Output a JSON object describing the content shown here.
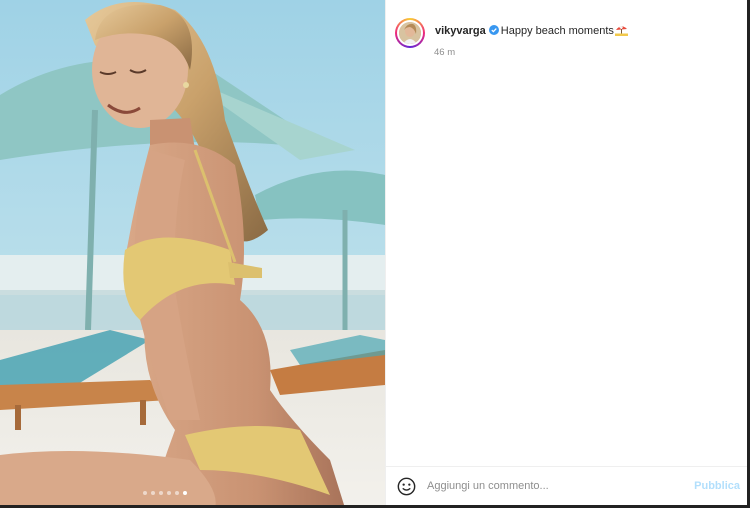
{
  "post": {
    "username": "vikyvarga",
    "caption": "Happy beach moments",
    "caption_emoji": "beach-umbrella-emoji",
    "time": "46 m"
  },
  "carousel": {
    "slide_count": 6,
    "active_index": 5
  },
  "comment_box": {
    "placeholder": "Aggiungi un commento...",
    "publish_label": "Pubblica"
  },
  "icons": {
    "verified": "verified-badge-icon",
    "emoji_picker": "smiley-icon"
  },
  "colors": {
    "verified_blue": "#3897f0",
    "publish_disabled": "#b2dffc",
    "muted_text": "#8e8e8e"
  }
}
